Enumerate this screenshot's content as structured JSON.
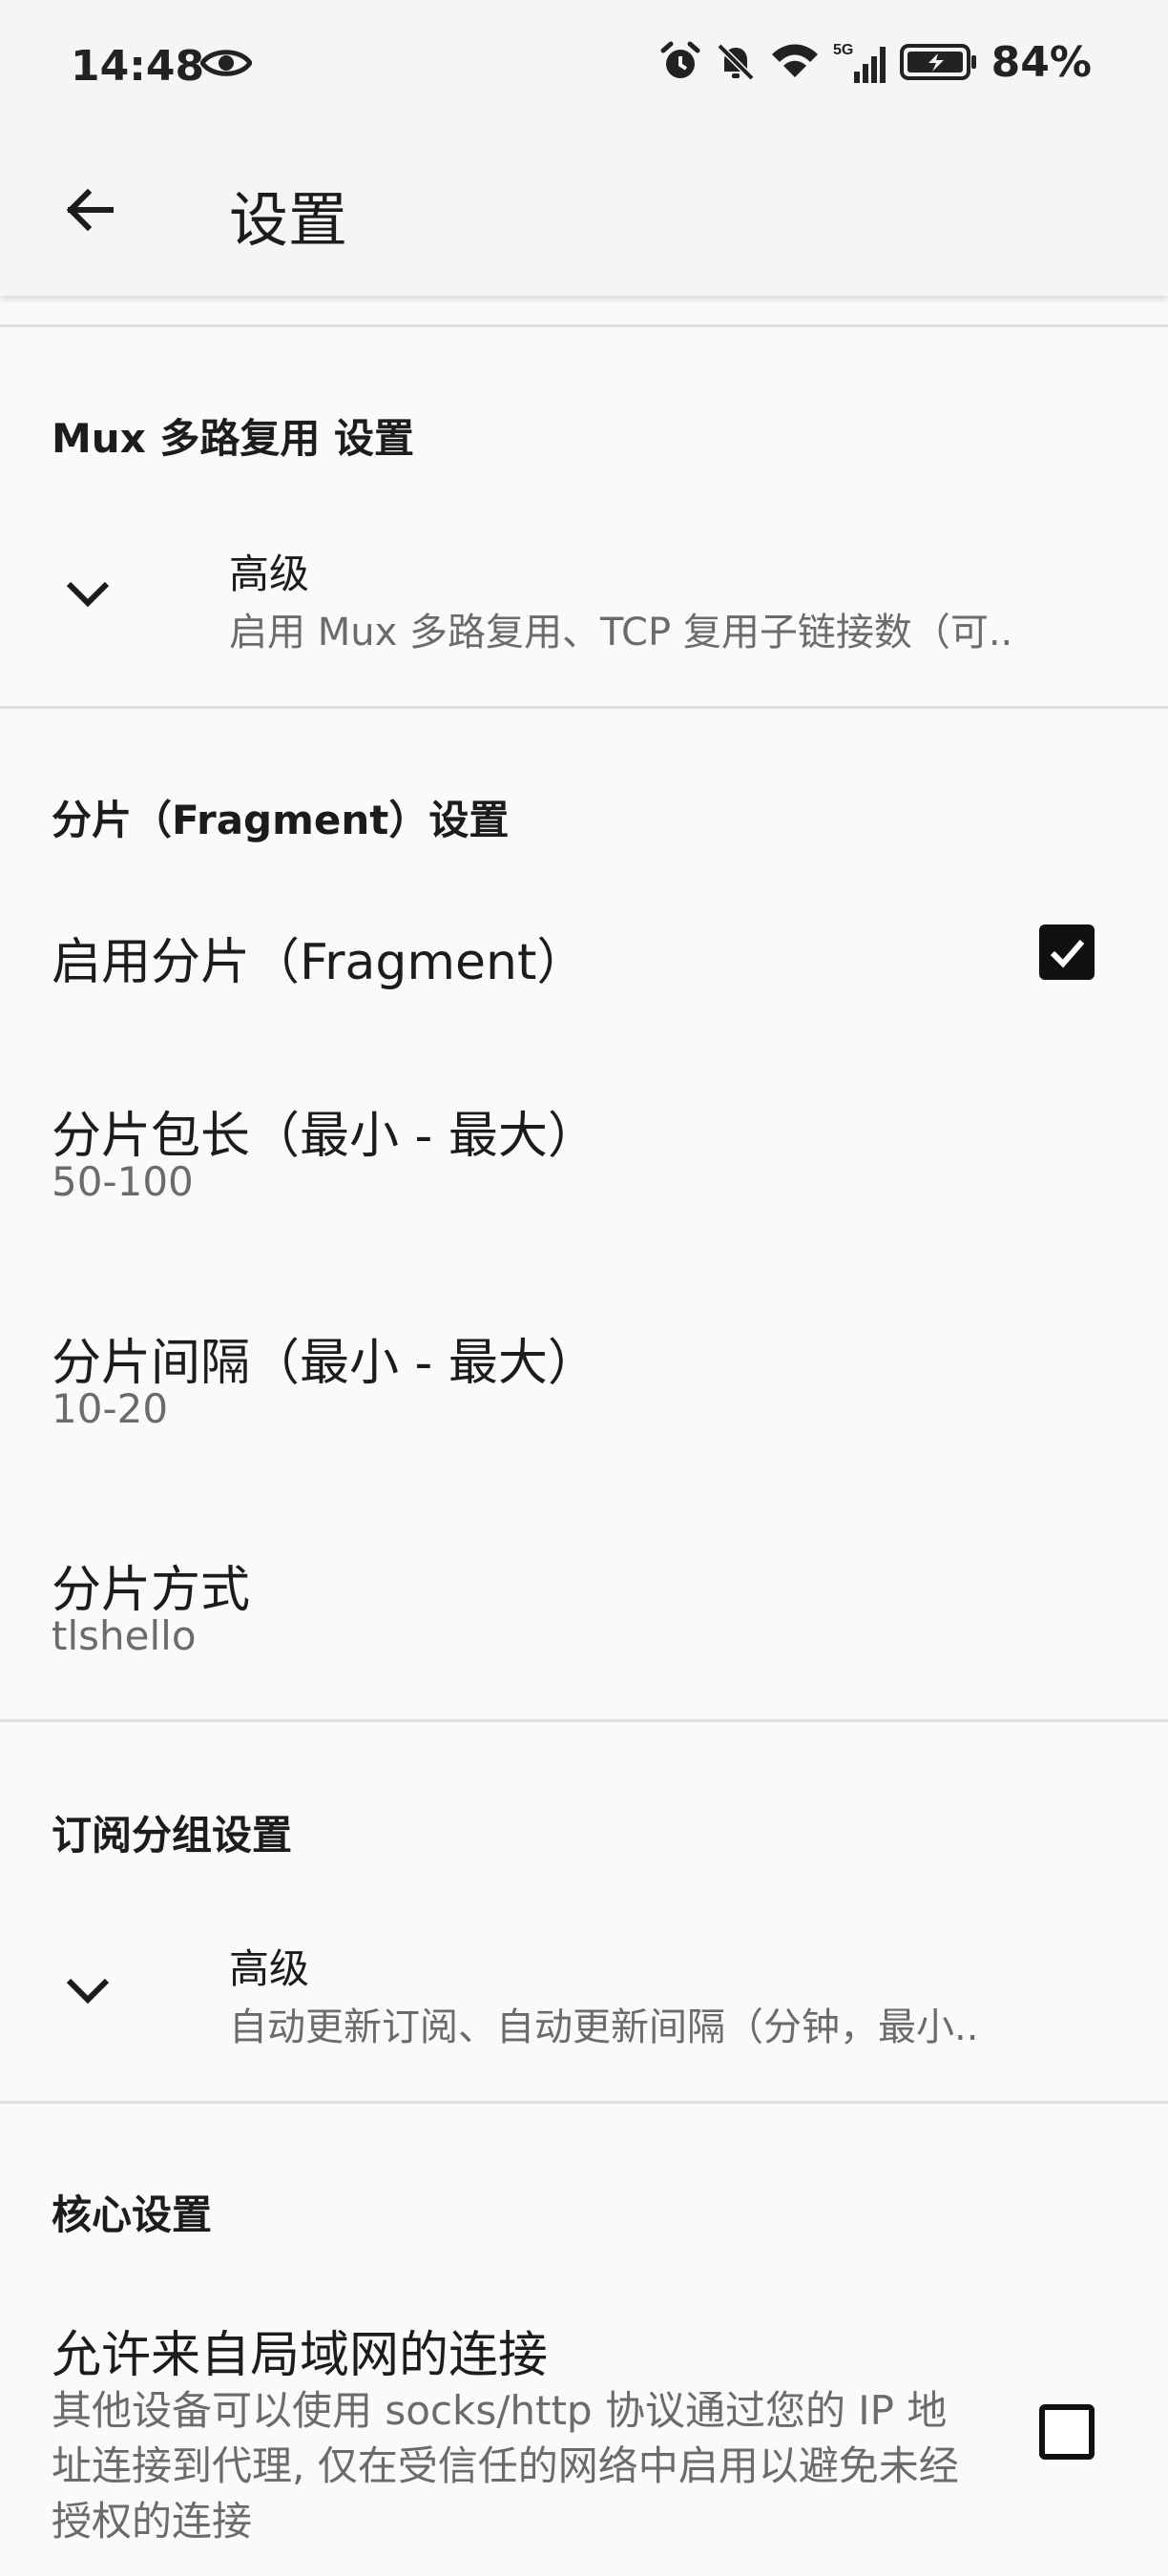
{
  "status": {
    "time": "14:48",
    "network": "5G",
    "battery": "84%"
  },
  "app_bar": {
    "title": "设置"
  },
  "mux_section": {
    "header": "Mux 多路复用 设置",
    "advanced_title": "高级",
    "advanced_summary": "启用 Mux 多路复用、TCP 复用子链接数（可.."
  },
  "fragment_section": {
    "header": "分片（Fragment）设置",
    "enable_label": "启用分片（Fragment）",
    "enable_checked": true,
    "length_label": "分片包长（最小 - 最大）",
    "length_value": "50-100",
    "interval_label": "分片间隔（最小 - 最大）",
    "interval_value": "10-20",
    "method_label": "分片方式",
    "method_value": "tlshello"
  },
  "subscription_section": {
    "header": "订阅分组设置",
    "advanced_title": "高级",
    "advanced_summary": "自动更新订阅、自动更新间隔（分钟，最小.."
  },
  "core_section": {
    "header": "核心设置",
    "lan_label": "允许来自局域网的连接",
    "lan_description": "其他设备可以使用 socks/http 协议通过您的 IP 地址连接到代理, 仅在受信任的网络中启用以避免未经授权的连接",
    "lan_checked": false
  }
}
